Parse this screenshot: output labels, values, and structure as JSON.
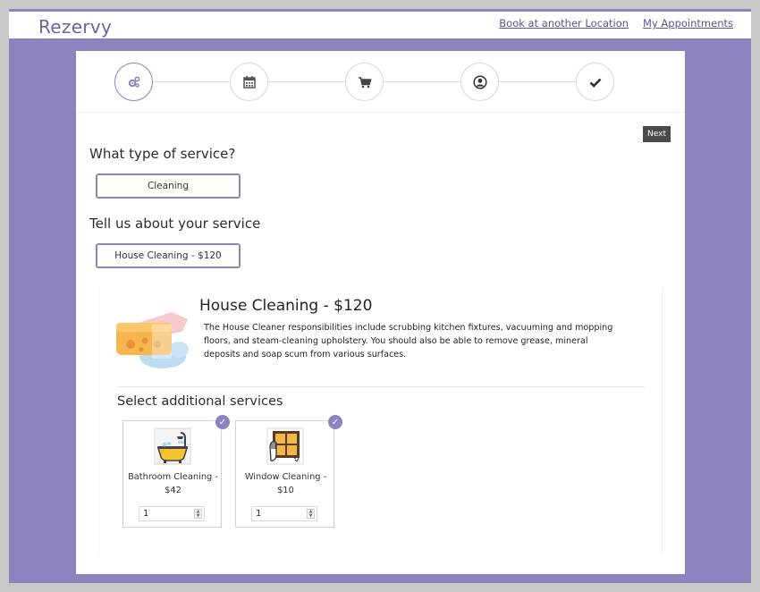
{
  "header": {
    "brand": "Rezervy",
    "links": [
      "Book at another Location",
      "My Appointments"
    ]
  },
  "steps": [
    {
      "icon": "gears-icon",
      "active": true
    },
    {
      "icon": "calendar-icon",
      "active": false
    },
    {
      "icon": "cart-icon",
      "active": false
    },
    {
      "icon": "user-icon",
      "active": false
    },
    {
      "icon": "check-icon",
      "active": false
    }
  ],
  "actions": {
    "next_label": "Next"
  },
  "service_type": {
    "question": "What type of service?",
    "selected": "Cleaning"
  },
  "service": {
    "question": "Tell us about your service",
    "selected": "House Cleaning - $120"
  },
  "detail": {
    "title": "House Cleaning - $120",
    "description": "The House Cleaner responsibilities include scrubbing kitchen fixtures, vacuuming and mopping floors, and steam-cleaning upholstery. You should also be able to remove grease, mineral deposits and soap scum from various surfaces.",
    "additional_title": "Select additional services",
    "addons": [
      {
        "label": "Bathroom Cleaning - $42",
        "qty": "1",
        "icon": "bathtub-icon",
        "checked": true
      },
      {
        "label": "Window Cleaning - $10",
        "qty": "1",
        "icon": "window-icon",
        "checked": true
      }
    ]
  },
  "colors": {
    "accent": "#8d83bd",
    "brand_text": "#6a64a4",
    "next_button": "#4a4a4a"
  }
}
